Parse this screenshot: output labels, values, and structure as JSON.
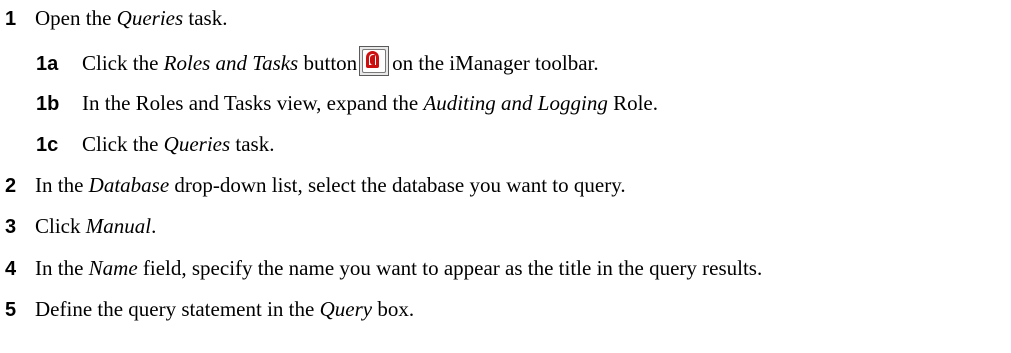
{
  "steps": [
    {
      "num": "1",
      "parts": [
        "Open the ",
        "Queries",
        " task."
      ]
    },
    {
      "num": "1a",
      "parts": [
        "Click the ",
        "Roles and Tasks",
        " button",
        "on the iManager toolbar."
      ],
      "icon": "roles-and-tasks-icon"
    },
    {
      "num": "1b",
      "parts": [
        "In the Roles and Tasks view, expand the ",
        "Auditing and Logging",
        " Role."
      ]
    },
    {
      "num": "1c",
      "parts": [
        "Click the ",
        "Queries",
        " task."
      ]
    },
    {
      "num": "2",
      "parts": [
        "In the ",
        "Database",
        " drop-down list, select the database you want to query."
      ]
    },
    {
      "num": "3",
      "parts": [
        "Click ",
        "Manual",
        "."
      ]
    },
    {
      "num": "4",
      "parts": [
        "In the ",
        "Name",
        " field, specify the name you want to appear as the title in the query results."
      ]
    },
    {
      "num": "5",
      "parts": [
        "Define the query statement in the ",
        "Query",
        " box."
      ]
    }
  ]
}
